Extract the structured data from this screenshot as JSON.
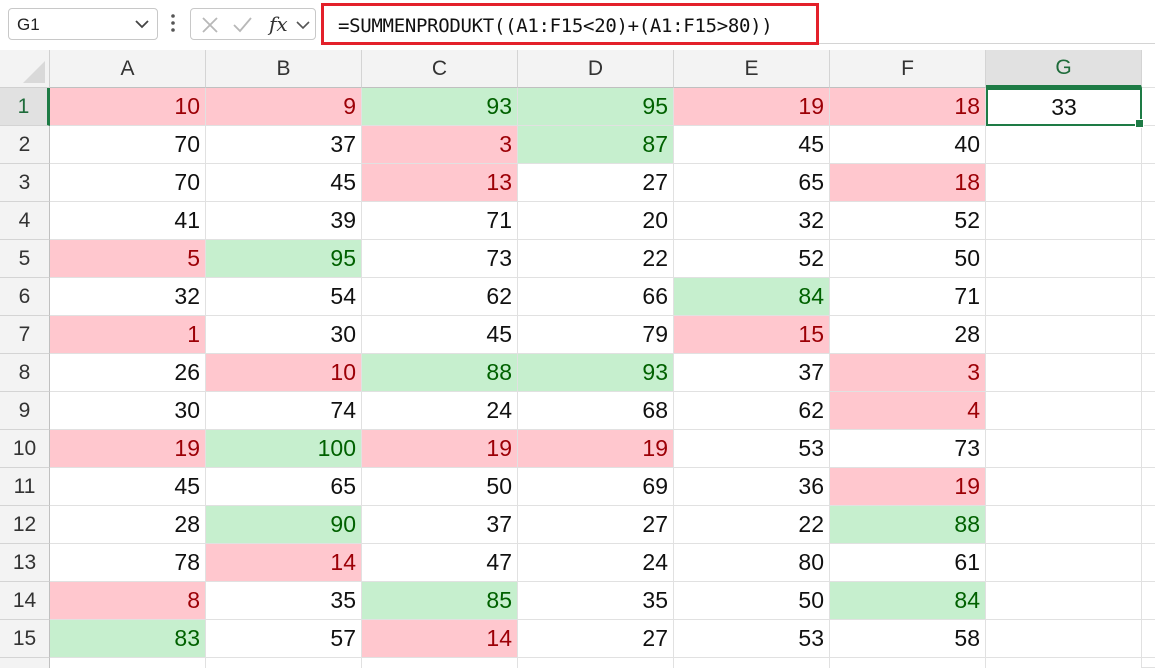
{
  "formula_bar": {
    "name_box": "G1",
    "formula": "=SUMMENPRODUKT((A1:F15<20)+(A1:F15>80))"
  },
  "columns": [
    "A",
    "B",
    "C",
    "D",
    "E",
    "F",
    "G"
  ],
  "selected_column": "G",
  "selected_row": 1,
  "rows": [
    [
      10,
      9,
      93,
      95,
      19,
      18
    ],
    [
      70,
      37,
      3,
      87,
      45,
      40
    ],
    [
      70,
      45,
      13,
      27,
      65,
      18
    ],
    [
      41,
      39,
      71,
      20,
      32,
      52
    ],
    [
      5,
      95,
      73,
      22,
      52,
      50
    ],
    [
      32,
      54,
      62,
      66,
      84,
      71
    ],
    [
      1,
      30,
      45,
      79,
      15,
      28
    ],
    [
      26,
      10,
      88,
      93,
      37,
      3
    ],
    [
      30,
      74,
      24,
      68,
      62,
      4
    ],
    [
      19,
      100,
      19,
      19,
      53,
      73
    ],
    [
      45,
      65,
      50,
      69,
      36,
      19
    ],
    [
      28,
      90,
      37,
      27,
      22,
      88
    ],
    [
      78,
      14,
      47,
      24,
      80,
      61
    ],
    [
      8,
      35,
      85,
      35,
      50,
      84
    ],
    [
      83,
      57,
      14,
      27,
      53,
      58
    ]
  ],
  "result_cell": {
    "ref": "G1",
    "value": "33"
  },
  "conditional_format": {
    "low_fill": "#ffc7ce",
    "low_text": "#9c0006",
    "high_fill": "#c6efce",
    "high_text": "#006100"
  },
  "accent_color": "#1e7b45",
  "highlight_box_color": "#e3202a",
  "icons": {
    "name_box_dropdown": "chevron-down-icon",
    "more": "vertical-dots-icon",
    "cancel": "cancel-x-icon",
    "enter": "checkmark-icon",
    "function": "fx-icon",
    "function_dropdown": "chevron-down-icon"
  }
}
